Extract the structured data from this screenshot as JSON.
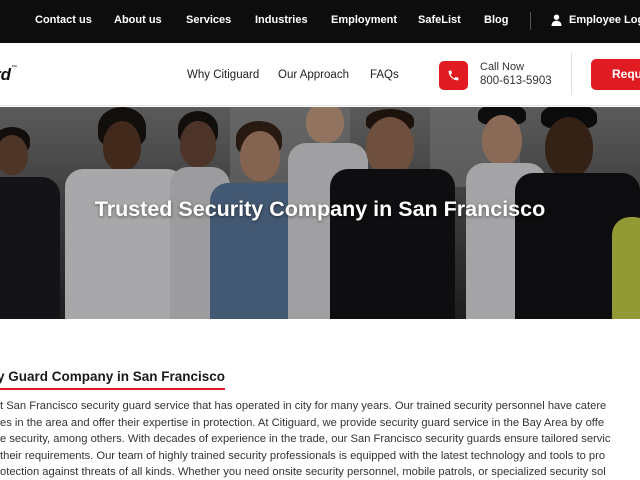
{
  "topbar": {
    "links": [
      "Contact us",
      "About us",
      "Services",
      "Industries",
      "Employment",
      "SafeList",
      "Blog"
    ],
    "employee_login": "Employee Login"
  },
  "header": {
    "logo_text": "rd",
    "logo_tm": "™",
    "nav": [
      "Why Citiguard",
      "Our Approach",
      "FAQs"
    ],
    "call_label": "Call Now",
    "call_number": "800-613-5903",
    "request_label": "Requ"
  },
  "hero": {
    "title": "Trusted Security Company in San Francisco"
  },
  "content": {
    "heading": "y Guard Company in San Francisco",
    "lines": [
      "t San Francisco security guard service that has operated in city for many years. Our trained security personnel have catere",
      "es in the area and offer their expertise in protection. At Citiguard, we provide security guard service in the Bay Area by offe",
      "e security, among others. With decades of experience in the trade, our San Francisco security guards ensure tailored servic",
      "their requirements. Our team of highly trained security professionals is equipped with the latest technology and tools to pro",
      "otection against threats of all kinds. Whether you need onsite security personnel, mobile patrols, or specialized security sol"
    ]
  },
  "colors": {
    "brand_red": "#e11b22",
    "topbar_bg": "#0d0d0d"
  },
  "icons": [
    "person-icon",
    "phone-icon"
  ]
}
